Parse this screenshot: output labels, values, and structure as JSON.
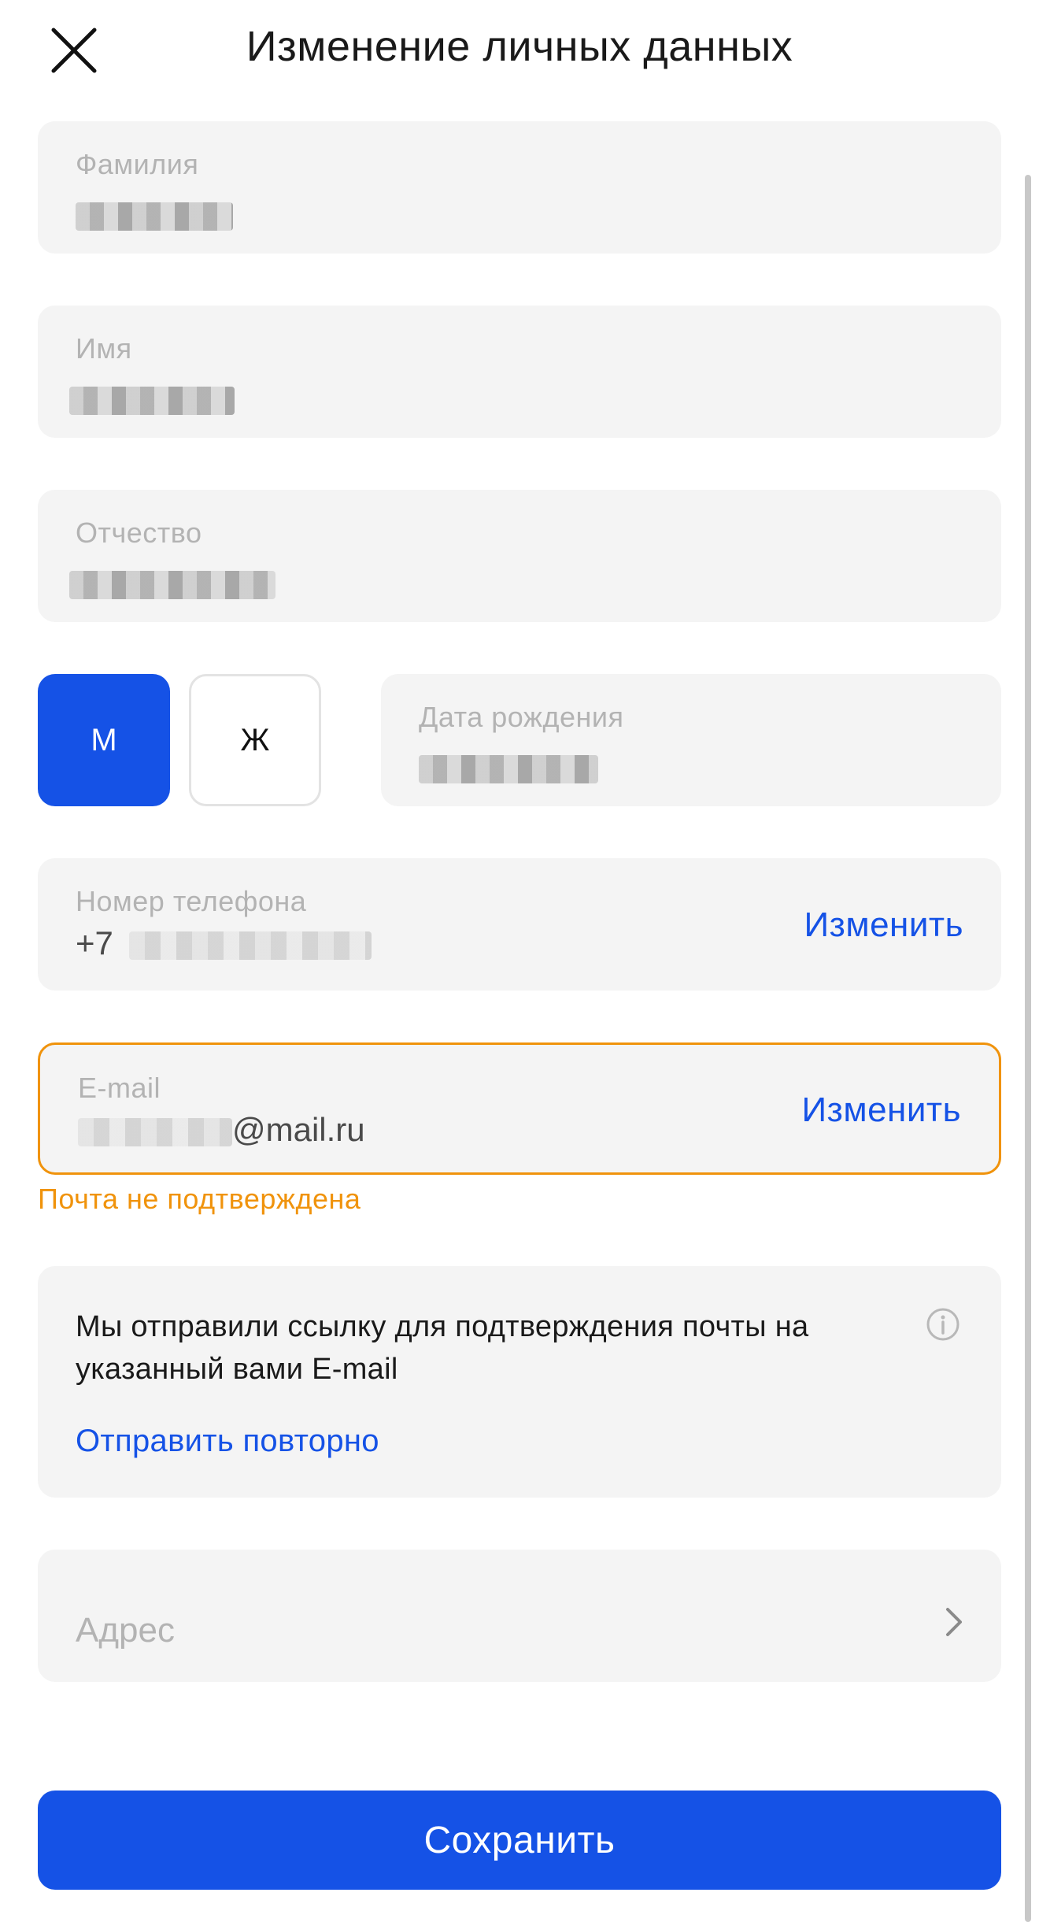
{
  "header": {
    "title": "Изменение личных данных",
    "close_icon": "close-icon"
  },
  "fields": {
    "last_name": {
      "label": "Фамилия"
    },
    "first_name": {
      "label": "Имя"
    },
    "patronymic": {
      "label": "Отчество"
    },
    "birth_date": {
      "label": "Дата рождения"
    },
    "phone": {
      "label": "Номер телефона",
      "prefix": "+7",
      "action": "Изменить"
    },
    "email": {
      "label": "E-mail",
      "suffix": "@mail.ru",
      "action": "Изменить",
      "warning": "Почта не подтверждена"
    },
    "address": {
      "placeholder": "Адрес"
    }
  },
  "gender": {
    "male": "М",
    "female": "Ж",
    "selected": "М"
  },
  "notice": {
    "text": "Мы отправили ссылку для подтверждения почты на указанный вами E-mail",
    "link": "Отправить повторно"
  },
  "save_button": "Сохранить",
  "colors": {
    "accent": "#1552e6",
    "warning": "#f0930c",
    "field_bg": "#f4f4f4"
  }
}
